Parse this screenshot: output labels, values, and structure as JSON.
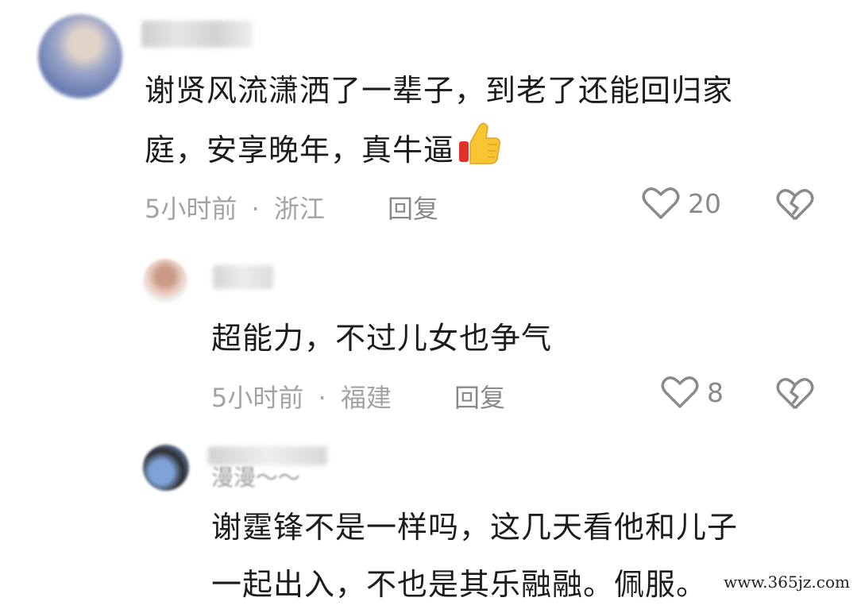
{
  "comments": [
    {
      "text_line1": "谢贤风流潇洒了一辈子，到老了还能回归家",
      "text_line2": "庭，安享晚年，真牛逼",
      "emoji": "thumbs-up",
      "time": "5小时前",
      "separator": "·",
      "location": "浙江",
      "reply_label": "回复",
      "likes": "20"
    },
    {
      "text_line1": "超能力，不过儿女也争气",
      "time": "5小时前",
      "separator": "·",
      "location": "福建",
      "reply_label": "回复",
      "likes": "8"
    },
    {
      "username": "漫漫～～",
      "text_line1": "谢霆锋不是一样吗，这几天看他和儿子",
      "text_line2": "一起出入，不也是其乐融融。佩服。"
    }
  ],
  "watermark": "www.365jz.com",
  "colors": {
    "text": "#1c1c1c",
    "meta": "#a3a3a3",
    "icon": "#8a8a8a"
  },
  "icons": [
    "heart-icon",
    "broken-heart-icon",
    "thumbs-up-icon"
  ]
}
